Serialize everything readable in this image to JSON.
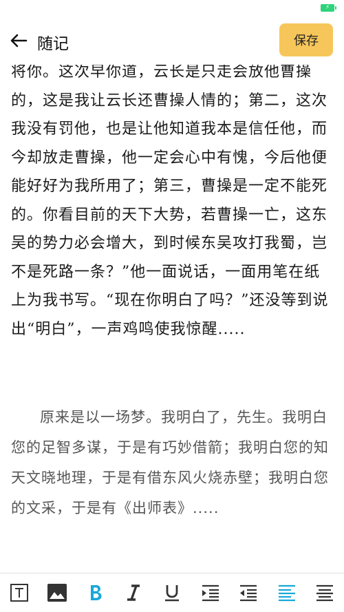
{
  "header": {
    "title": "随记",
    "save_label": "保存"
  },
  "content": {
    "paragraph1": "将你。这次早你道，云长是只走会放他曹操的，这是我让云长还曹操人情的；第二，这次我没有罚他，也是让他知道我本是信任他，而今却放走曹操，他一定会心中有愧，今后他便能好好为我所用了；第三，曹操是一定不能死的。你看目前的天下大势，若曹操一亡，这东吴的势力必会增大，到时候东吴攻打我蜀，岂不是死路一条？”他一面说话，一面用笔在纸上为我书写。“现在你明白了吗？”还没等到说出“明白”，一声鸡鸣使我惊醒.....",
    "paragraph2": "原来是以一场梦。我明白了，先生。我明白您的足智多谋，于是有巧妙借箭；我明白您的知天文晓地理，于是有借东风火烧赤壁；我明白您的文采，于是有《出师表》....."
  },
  "toolbar": {
    "active_color": "#18a8d8",
    "icon_color": "#333333",
    "tools": [
      "text-box-icon",
      "image-icon",
      "bold-icon",
      "italic-icon",
      "underline-icon",
      "indent-increase-icon",
      "indent-decrease-icon",
      "align-left-icon",
      "align-justify-icon"
    ]
  },
  "status": {
    "battery_color": "#2fd37a"
  }
}
